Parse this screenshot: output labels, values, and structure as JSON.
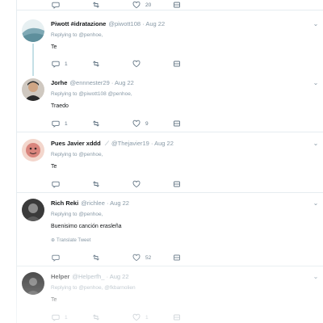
{
  "top_bar": {
    "like_count": "20"
  },
  "tweets": [
    {
      "name": "Piwott #idratazione",
      "handle": "@piwott108",
      "date": "· Aug 22",
      "replying": "Replying to @penhoe,",
      "text": "Te",
      "reply_count": "1",
      "retweet_count": "",
      "like_count": "",
      "avatar_colors": [
        "#7fa9b5",
        "#e7f0f2"
      ]
    },
    {
      "name": "Jorhe",
      "handle": "@ennnester29",
      "date": "· Aug 22",
      "replying": "Replying to @piwott108 @penhoe,",
      "text": "Traedo",
      "reply_count": "1",
      "retweet_count": "",
      "like_count": "9",
      "avatar_colors": [
        "#2a2a2a",
        "#cfa584"
      ]
    },
    {
      "name": "Pues Javier xddd",
      "handle": "@Thejavier19",
      "date": "· Aug 22",
      "replying": "Replying to @penhoe,",
      "text": "Te",
      "reply_count": "",
      "retweet_count": "",
      "like_count": "",
      "avatar_colors": [
        "#d9857d",
        "#f3d6cc"
      ]
    },
    {
      "name": "Rich Reki",
      "handle": "@richlee",
      "date": "· Aug 22",
      "replying": "Replying to @penhoe,",
      "text": "Buenisimo canción erasleña",
      "translate": "Translate Tweet",
      "reply_count": "",
      "retweet_count": "",
      "like_count": "52",
      "avatar_colors": [
        "#3a3a3a",
        "#8b8b8b"
      ]
    },
    {
      "name": "Helper",
      "handle": "@Helperfh_",
      "date": "· Aug 22",
      "replying": "Replying to @penhoe, @fkbarnolien",
      "text": "Te",
      "reply_count": "1",
      "retweet_count": "",
      "like_count": "1",
      "avatar_colors": [
        "#1f1f1f",
        "#6b6b6b"
      ]
    }
  ],
  "icons": {
    "reply": "reply-icon",
    "retweet": "retweet-icon",
    "like": "heart-icon",
    "share": "share-icon",
    "more": "chevron-down-icon"
  },
  "colors": {
    "divider": "#e6ecf0",
    "muted": "#8899a6",
    "thread_line": "#c4e0e6"
  }
}
